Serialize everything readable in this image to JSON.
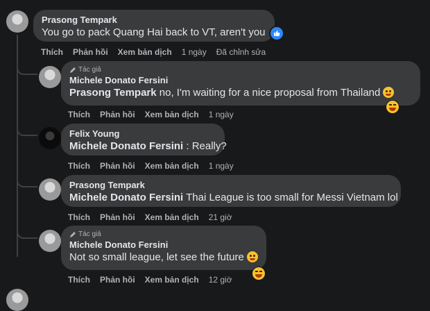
{
  "comments": [
    {
      "author": "Prasong Tempark",
      "text": "You go to pack Quang Hai back to VT, aren't you",
      "actions": [
        "Thích",
        "Phản hồi",
        "Xem bản dịch"
      ],
      "time": "1 ngày",
      "edited": "Đã chỉnh sửa",
      "reaction_icon": "like-icon"
    }
  ],
  "replies": [
    {
      "badge": "Tác giả",
      "author": "Michele Donato Fersini",
      "mention": "Prasong Tempark",
      "text": " no, I'm waiting for a nice proposal from Thailand",
      "actions": [
        "Thích",
        "Phản hồi",
        "Xem bản dịch"
      ],
      "time": "1 ngày"
    },
    {
      "author": "Felix Young",
      "mention": "Michele Donato Fersini",
      "text": " : Really?",
      "actions": [
        "Thích",
        "Phản hồi",
        "Xem bản dịch"
      ],
      "time": "1 ngày"
    },
    {
      "author": "Prasong Tempark",
      "mention": "Michele Donato Fersini",
      "text": " Thai League is too small for Messi Vietnam lol",
      "actions": [
        "Thích",
        "Phản hồi",
        "Xem bản dịch"
      ],
      "time": "21 giờ"
    },
    {
      "badge": "Tác giả",
      "author": "Michele Donato Fersini",
      "text": "Not so small league, let see the future",
      "actions": [
        "Thích",
        "Phản hồi",
        "Xem bản dịch"
      ],
      "time": "12 giờ"
    }
  ]
}
